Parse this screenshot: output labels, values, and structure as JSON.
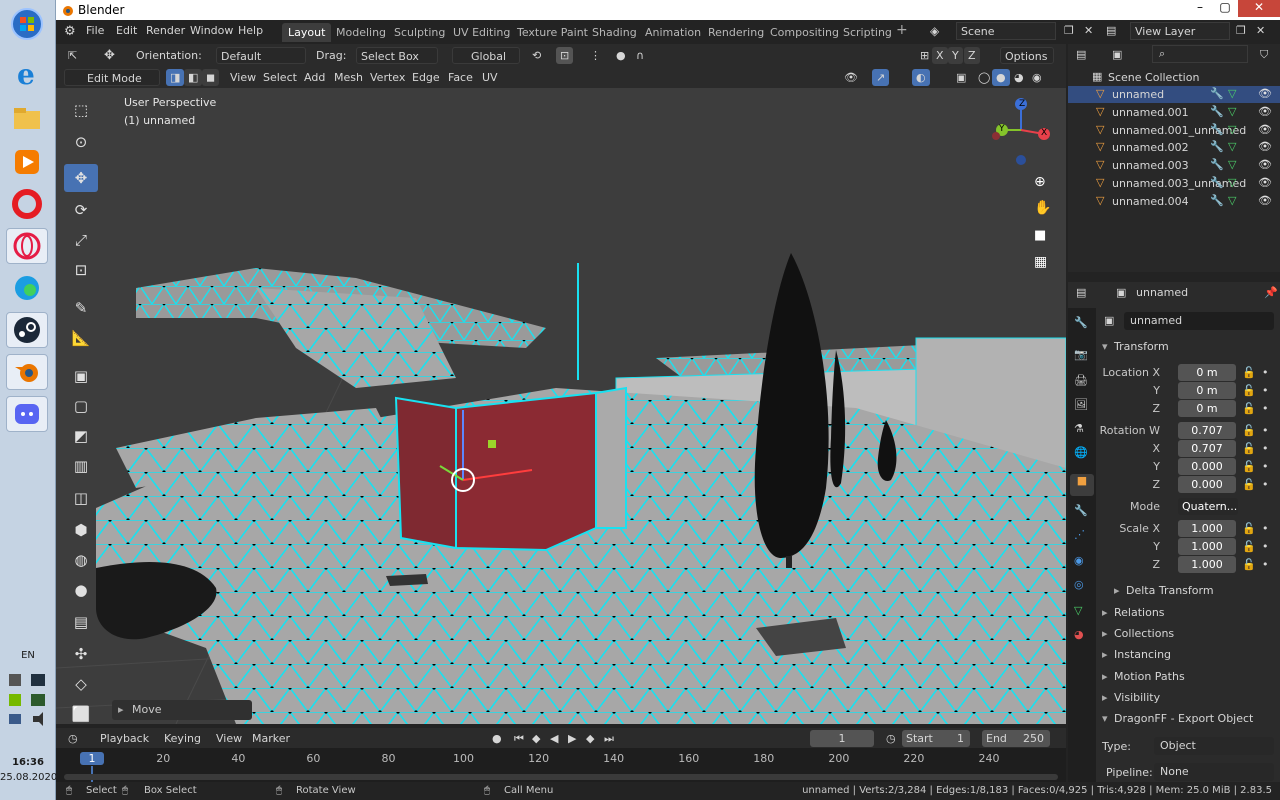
{
  "taskbar": {
    "language": "EN",
    "time": "16:36",
    "date": "25.08.2020"
  },
  "window": {
    "title": "Blender",
    "controls": [
      "–",
      "▢",
      "✕"
    ]
  },
  "topbar": {
    "menus": [
      "File",
      "Edit",
      "Render",
      "Window",
      "Help"
    ],
    "workspaces": [
      "Layout",
      "Modeling",
      "Sculpting",
      "UV Editing",
      "Texture Paint",
      "Shading",
      "Animation",
      "Rendering",
      "Compositing",
      "Scripting"
    ],
    "active_workspace": "Layout",
    "scene": "Scene",
    "view_layer": "View Layer"
  },
  "header2": {
    "orientation_label": "Orientation:",
    "orientation_value": "Default",
    "drag_label": "Drag:",
    "drag_value": "Select Box",
    "transform_space": "Global",
    "axes": [
      "X",
      "Y",
      "Z"
    ],
    "options": "Options"
  },
  "header3": {
    "mode": "Edit Mode",
    "menus": [
      "View",
      "Select",
      "Add",
      "Mesh",
      "Vertex",
      "Edge",
      "Face",
      "UV"
    ]
  },
  "viewport": {
    "perspective": "User Perspective",
    "object": "(1) unnamed",
    "last_op": "Move",
    "gizmo_axes": [
      "X",
      "Y",
      "Z"
    ]
  },
  "outliner": {
    "collection": "Scene Collection",
    "items": [
      "unnamed",
      "unnamed.001",
      "unnamed.001_unnamed",
      "unnamed.002",
      "unnamed.003",
      "unnamed.003_unnamed",
      "unnamed.004"
    ]
  },
  "properties": {
    "object_name": "unnamed",
    "object_field": "unnamed",
    "transform_title": "Transform",
    "location": {
      "label_x": "Location X",
      "x": "0 m",
      "y": "0 m",
      "z": "0 m"
    },
    "rotation": {
      "label_w": "Rotation W",
      "w": "0.707",
      "x": "0.707",
      "y": "0.000",
      "z": "0.000"
    },
    "mode_label": "Mode",
    "mode_value": "Quatern...",
    "scale": {
      "label_x": "Scale X",
      "x": "1.000",
      "y": "1.000",
      "z": "1.000"
    },
    "axis_labels": [
      "Y",
      "Z",
      "X",
      "Y",
      "Z",
      "Y",
      "Z"
    ],
    "sections": [
      "Delta Transform",
      "Relations",
      "Collections",
      "Instancing",
      "Motion Paths",
      "Visibility",
      "DragonFF - Export Object"
    ],
    "type_label": "Type:",
    "type_value": "Object",
    "pipeline_label": "Pipeline:",
    "pipeline_value": "None"
  },
  "timeline": {
    "menus": [
      "Playback",
      "Keying",
      "View",
      "Marker"
    ],
    "current_frame": "1",
    "start_label": "Start",
    "start": "1",
    "end_label": "End",
    "end": "250",
    "ticks": [
      "1",
      "20",
      "40",
      "60",
      "80",
      "100",
      "120",
      "140",
      "160",
      "180",
      "200",
      "220",
      "240"
    ]
  },
  "statusbar": {
    "select": "Select",
    "box_select": "Box Select",
    "rotate_view": "Rotate View",
    "call_menu": "Call Menu",
    "stats": "unnamed | Verts:2/3,284 | Edges:1/8,183 | Faces:0/4,925 | Tris:4,928 | Mem: 25.0 MiB | 2.83.5"
  },
  "colors": {
    "accent": "#4772b3",
    "wire": "#00e5ff",
    "face_selected": "#8b2a33",
    "viewport_bg": "#3d3d3d"
  }
}
